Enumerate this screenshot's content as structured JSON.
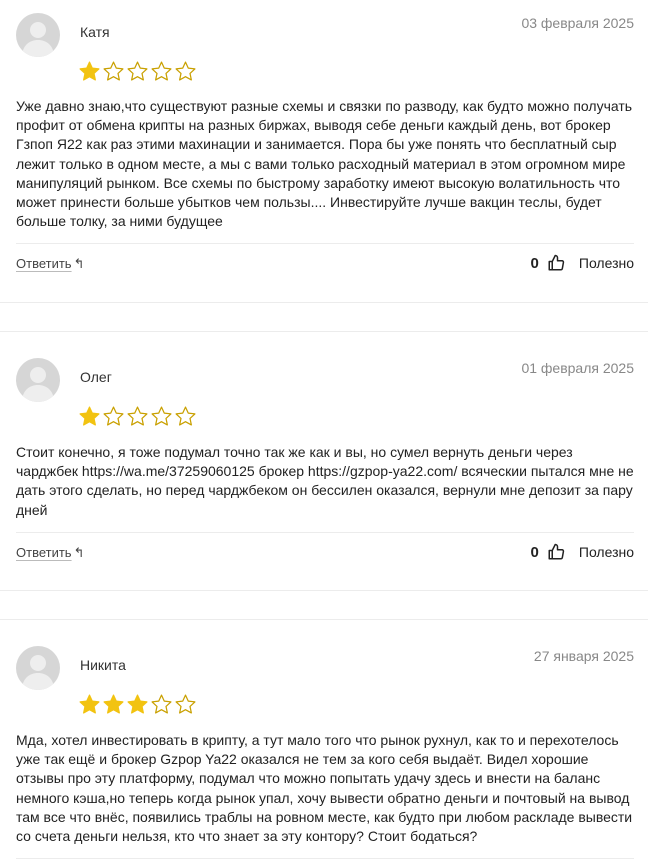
{
  "colors": {
    "star_filled": "#f2c311",
    "star_empty_stroke": "#c9a000",
    "avatar_bg": "#d6d6d6"
  },
  "reviews": [
    {
      "author": "Катя",
      "date": "03 февраля 2025",
      "rating": 1,
      "max_rating": 5,
      "text": "Уже давно знаю,что существуют разные схемы и связки по разводу, как будто можно получать профит от обмена крипты на разных биржах, выводя себе деньги каждый день, вот брокер Гзпоп Я22 как раз этими махинации и занимается. Пора бы уже понять что бесплатный сыр лежит только в одном месте, а мы с вами только расходный материал в этом огромном мире манипуляций рынком. Все схемы по быстрому заработку имеют высокую волатильность что может принести больше убытков чем пользы.... Инвестируйте лучше вакцин теслы, будет больше толку, за ними будущее",
      "reply_label": "Ответить",
      "likes": "0",
      "useful_label": "Полезно"
    },
    {
      "author": "Олег",
      "date": "01 февраля 2025",
      "rating": 1,
      "max_rating": 5,
      "text_before_link": "Стоит конечно, я тоже подумал точно так же как и вы, но сумел вернуть деньги через чарджбек ",
      "link": "https://wa.me/37259060125",
      "text_after_link": " брокер https://gzpop-ya22.com/ всяческии пытался мне не дать этого сделать, но перед чарджбеком он бессилен оказался, вернули мне депозит за пару дней",
      "reply_label": "Ответить",
      "likes": "0",
      "useful_label": "Полезно"
    },
    {
      "author": "Никита",
      "date": "27 января 2025",
      "rating": 3,
      "max_rating": 5,
      "text": "Мда, хотел инвестировать в крипту, а тут мало того что рынок рухнул, как то и перехотелось уже так ещё и брокер Gzpop Ya22 оказался не тем за кого себя выдаёт. Видел хорошие отзывы про эту платформу, подумал что можно попытать удачу здесь и внести на баланс немного кэша,но теперь когда рынок упал, хочу вывести обратно деньги и почтовый на вывод там все что внёс, появились траблы на ровном месте, как будто при любом раскладе вывести со счета деньги нельзя, кто что знает за эту контору? Стоит бодаться?"
    }
  ]
}
